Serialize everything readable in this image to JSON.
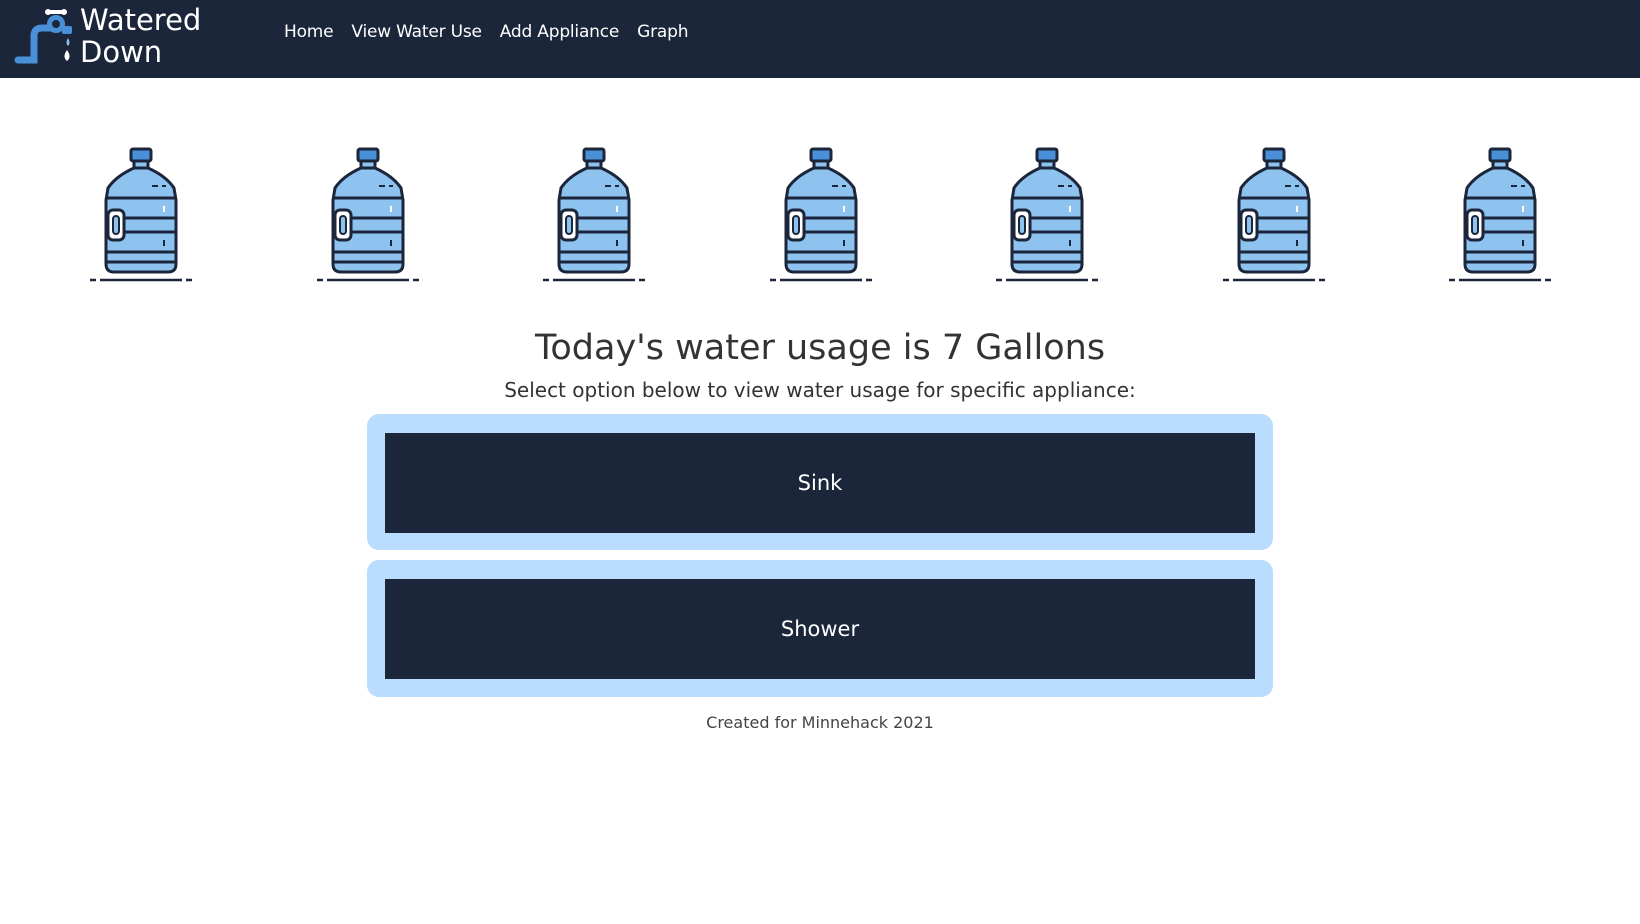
{
  "brand": {
    "line1": "Watered",
    "line2": "Down"
  },
  "nav": [
    {
      "label": "Home"
    },
    {
      "label": "View Water Use"
    },
    {
      "label": "Add Appliance"
    },
    {
      "label": "Graph"
    }
  ],
  "usage": {
    "gallons": 7,
    "headline": "Today's water usage is 7 Gallons",
    "subline": "Select option below to view water usage for specific appliance:"
  },
  "appliances": [
    {
      "label": "Sink"
    },
    {
      "label": "Shower"
    }
  ],
  "footer": {
    "text": "Created for Minnehack 2021"
  },
  "colors": {
    "navbar": "#1c263a",
    "card": "#b9dcff",
    "jug_fill": "#8ec3f0",
    "jug_outline": "#1c263a",
    "jug_cap": "#4a90d9"
  },
  "icons": {
    "logo": "faucet-drop-icon",
    "jug": "water-jug-icon"
  }
}
